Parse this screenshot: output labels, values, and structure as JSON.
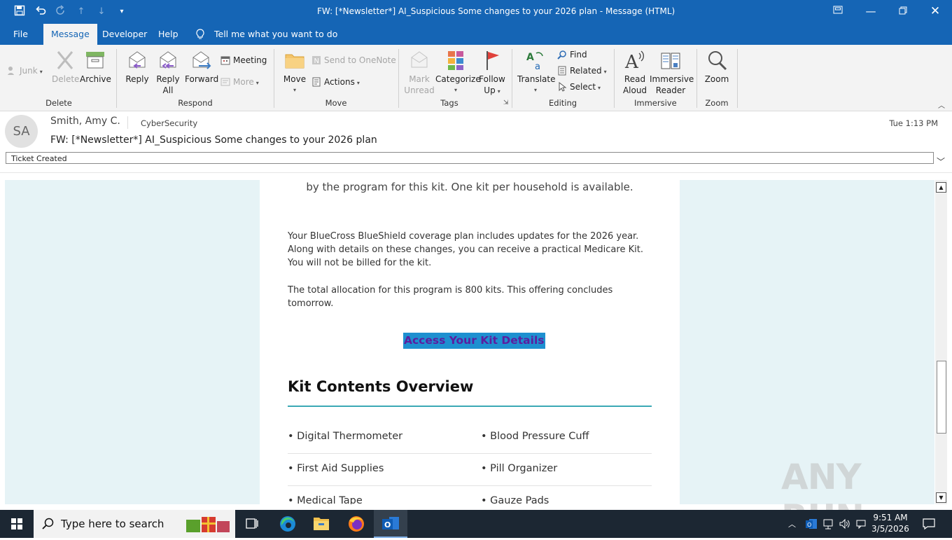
{
  "window": {
    "title": "FW: [*Newsletter*] AI_Suspicious Some changes to your 2026 plan  -  Message (HTML)"
  },
  "tabs": [
    {
      "label": "File"
    },
    {
      "label": "Message"
    },
    {
      "label": "Developer"
    },
    {
      "label": "Help"
    }
  ],
  "tell_me": "Tell me what you want to do",
  "ribbon": {
    "delete_group": {
      "label": "Delete",
      "junk": "Junk",
      "delete": "Delete",
      "archive": "Archive"
    },
    "respond_group": {
      "label": "Respond",
      "reply": "Reply",
      "reply_all_1": "Reply",
      "reply_all_2": "All",
      "forward": "Forward",
      "meeting": "Meeting",
      "more": "More"
    },
    "move_group": {
      "label": "Move",
      "move": "Move",
      "send_onenote": "Send to OneNote",
      "actions": "Actions"
    },
    "tags_group": {
      "label": "Tags",
      "mark_1": "Mark",
      "mark_2": "Unread",
      "categorize": "Categorize",
      "follow_1": "Follow",
      "follow_2": "Up"
    },
    "editing_group": {
      "label": "Editing",
      "translate": "Translate",
      "find": "Find",
      "related": "Related",
      "select": "Select"
    },
    "immersive_group": {
      "label": "Immersive",
      "read_1": "Read",
      "read_2": "Aloud",
      "imm_1": "Immersive",
      "imm_2": "Reader"
    },
    "zoom_group": {
      "label": "Zoom",
      "zoom": "Zoom"
    }
  },
  "message": {
    "avatar_initials": "SA",
    "sender": "Smith, Amy C.",
    "recipient": "CyberSecurity",
    "time": "Tue 1:13 PM",
    "subject": "FW: [*Newsletter*] AI_Suspicious Some changes to your 2026 plan",
    "tag": "Ticket Created"
  },
  "body": {
    "intro": "by the program for this kit. One kit per household is available.",
    "para1": "Your BlueCross BlueShield coverage plan includes updates for the 2026 year. Along with details on these changes, you can receive a practical Medicare Kit. You will not be billed for the kit.",
    "para2": "The total allocation for this program is 800 kits. This offering concludes tomorrow.",
    "cta": "Access Your Kit Details",
    "kit_title": "Kit Contents Overview",
    "kit_items": [
      "• Digital Thermometer",
      "• Blood Pressure Cuff",
      "• First Aid Supplies",
      "• Pill Organizer",
      "• Medical Tape",
      "• Gauze Pads"
    ]
  },
  "watermark": "ANY RUN",
  "taskbar": {
    "search_placeholder": "Type here to search",
    "time": "9:51 AM",
    "date": "3/5/2026"
  },
  "colors": {
    "titlebar": "#1565b5",
    "side_panel": "#e6f3f6",
    "cta_bg": "#1e90d0",
    "cta_text": "#5b1ea0",
    "accent_rule": "#3ba9b5"
  }
}
